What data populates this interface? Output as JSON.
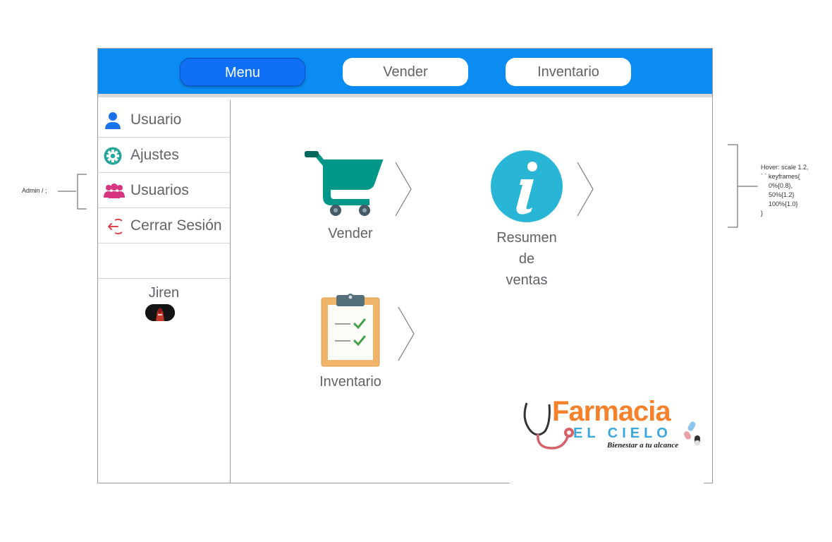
{
  "topbar": {
    "tabs": [
      {
        "label": "Menu",
        "active": true
      },
      {
        "label": "Vender",
        "active": false
      },
      {
        "label": "Inventario",
        "active": false
      }
    ]
  },
  "sidebar": {
    "items": [
      {
        "label": "Usuario",
        "icon": "user-icon"
      },
      {
        "label": "Ajustes",
        "icon": "gear-icon"
      },
      {
        "label": "Usuarios",
        "icon": "users-icon"
      },
      {
        "label": "Cerrar Sesión",
        "icon": "logout-icon"
      }
    ],
    "user_name": "Jiren"
  },
  "tiles": [
    {
      "label": "Vender",
      "icon": "shopping-cart-icon"
    },
    {
      "label_lines": [
        "Resumen",
        "de",
        "ventas"
      ],
      "icon": "info-icon"
    },
    {
      "label": "Inventario",
      "icon": "clipboard-checklist-icon"
    }
  ],
  "annotations": {
    "left_note": "Admin / ;",
    "right_note_lines": [
      "Hover: scale 1.2,",
      "` ` keyframes{",
      "0%{0.8},",
      "50%{1.2}",
      "100%{1.0}",
      "}"
    ]
  },
  "logo": {
    "title": "Farmacia",
    "subtitle": "EL CIELO",
    "tagline": "Bienestar a tu alcance"
  },
  "colors": {
    "topbar": "#0a8cf2",
    "active_tab": "#0f6ff5",
    "cart": "#009688",
    "info": "#29b6d6",
    "logo_orange": "#f5822a",
    "logo_blue": "#3aa8dc"
  }
}
